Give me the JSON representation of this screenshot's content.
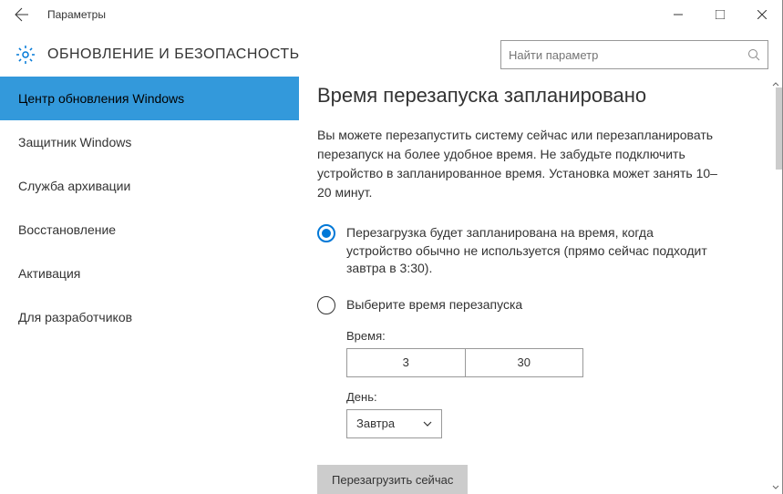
{
  "window": {
    "title": "Параметры"
  },
  "header": {
    "title": "ОБНОВЛЕНИЕ И БЕЗОПАСНОСТЬ",
    "search_placeholder": "Найти параметр"
  },
  "sidebar": {
    "items": [
      {
        "label": "Центр обновления Windows",
        "active": true
      },
      {
        "label": "Защитник Windows",
        "active": false
      },
      {
        "label": "Служба архивации",
        "active": false
      },
      {
        "label": "Восстановление",
        "active": false
      },
      {
        "label": "Активация",
        "active": false
      },
      {
        "label": "Для разработчиков",
        "active": false
      }
    ]
  },
  "main": {
    "heading": "Время перезапуска запланировано",
    "description": "Вы можете перезапустить систему сейчас или перезапланировать перезапуск на более удобное время. Не забудьте подключить устройство в запланированное время. Установка может занять 10–20 минут.",
    "radio_auto": "Перезагрузка будет запланирована на время, когда устройство обычно не используется (прямо сейчас подходит завтра в 3:30).",
    "radio_custom": "Выберите время перезапуска",
    "time_label": "Время:",
    "time_hour": "3",
    "time_minute": "30",
    "day_label": "День:",
    "day_value": "Завтра",
    "restart_button": "Перезагрузить сейчас"
  }
}
